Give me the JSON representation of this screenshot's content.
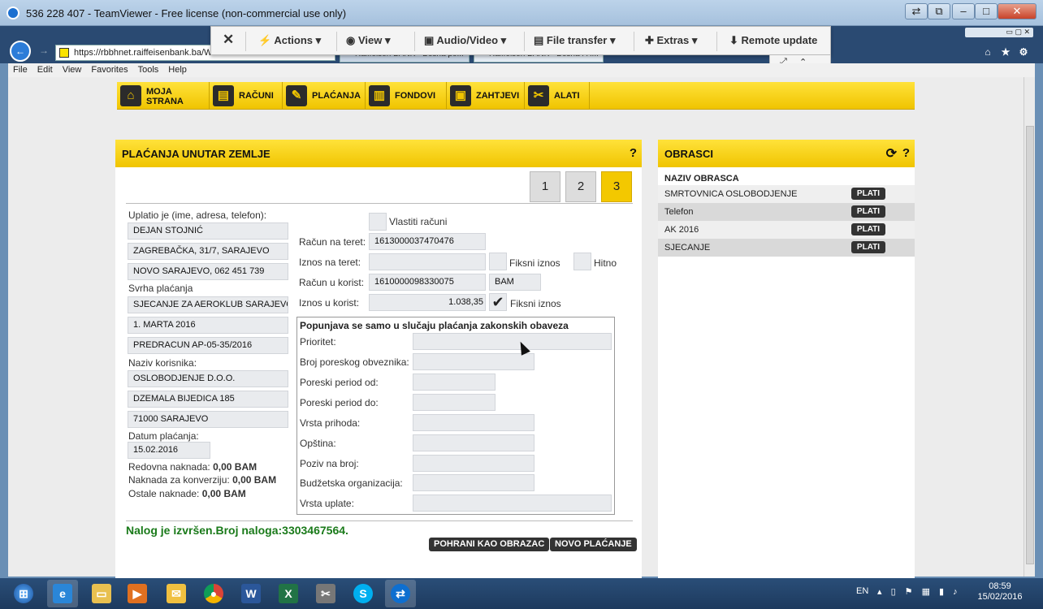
{
  "window": {
    "title": "536 228 407 - TeamViewer - Free license (non-commercial use only)"
  },
  "browser": {
    "url": "https://rbbhnet.raiffeisenbank.ba/WEB",
    "tab1": "Raiffeisen BANK - Bosna po...",
    "tab2": "Raiffeisen BANK - Bosna i H...",
    "menu": [
      "File",
      "Edit",
      "View",
      "Favorites",
      "Tools",
      "Help"
    ]
  },
  "teamviewer": {
    "close": "✕",
    "actions": "Actions",
    "view": "View",
    "audio": "Audio/Video",
    "file": "File transfer",
    "extras": "Extras",
    "remote": "Remote update"
  },
  "nav": {
    "home_line1": "MOJA",
    "home_line2": "STRANA",
    "racuni": "RAČUNI",
    "placanja": "PLAĆANJA",
    "fondovi": "FONDOVI",
    "zahtjevi": "ZAHTJEVI",
    "alati": "ALATI"
  },
  "main": {
    "title": "PLAĆANJA UNUTAR ZEMLJE",
    "help": "?",
    "steps": [
      "1",
      "2",
      "3"
    ],
    "payer_label": "Uplatio je (ime, adresa, telefon):",
    "payer": [
      "DEJAN STOJNIĆ",
      "ZAGREBAČKA, 31/7, SARAJEVO",
      "NOVO SARAJEVO, 062 451 739"
    ],
    "purpose_label": "Svrha plaćanja",
    "purpose": [
      "SJECANJE ZA AEROKLUB SARAJEVO",
      "1. MARTA 2016",
      "PREDRACUN AP-05-35/2016"
    ],
    "recipient_label": "Naziv korisnika:",
    "recipient": [
      "OSLOBODJENJE D.O.O.",
      "DZEMALA BIJEDICA 185",
      "71000 SARAJEVO"
    ],
    "date_label": "Datum plaćanja:",
    "date": "15.02.2016",
    "fee1_label": "Redovna naknada:",
    "fee1": "0,00 BAM",
    "fee2_label": "Naknada za konverziju:",
    "fee2": "0,00 BAM",
    "fee3_label": "Ostale naknade:",
    "fee3": "0,00 BAM",
    "own_accounts": "Vlastiti računi",
    "debit_account_label": "Račun na teret:",
    "debit_account": "1613000037470476",
    "debit_amount_label": "Iznos na teret:",
    "fixed_amount": "Fiksni iznos",
    "urgent": "Hitno",
    "credit_account_label": "Račun u korist:",
    "credit_account": "1610000098330075",
    "currency": "BAM",
    "credit_amount_label": "Iznos u korist:",
    "credit_amount": "1.038,35",
    "fixed_amount2": "Fiksni iznos",
    "legal_title": "Popunjava se samo u slučaju plaćanja zakonskih obaveza",
    "legal_fields": [
      "Prioritet:",
      "Broj poreskog obveznika:",
      "Poreski period od:",
      "Poreski period do:",
      "Vrsta prihoda:",
      "Opština:",
      "Poziv na broj:",
      "Budžetska organizacija:",
      "Vrsta uplate:"
    ],
    "status": "Nalog je izvršen.Broj naloga:3303467564.",
    "save_template": "POHRANI KAO OBRAZAC",
    "new_payment": "NOVO PLAĆANJE"
  },
  "side": {
    "title": "OBRASCI",
    "refresh": "⟳",
    "help": "?",
    "col": "NAZIV OBRASCA",
    "items": [
      "SMRTOVNICA OSLOBODJENJE",
      "Telefon",
      "AK 2016",
      "SJECANJE"
    ],
    "pay": "PLATI"
  },
  "tray": {
    "lang": "EN",
    "time": "08:59",
    "date": "15/02/2016"
  }
}
